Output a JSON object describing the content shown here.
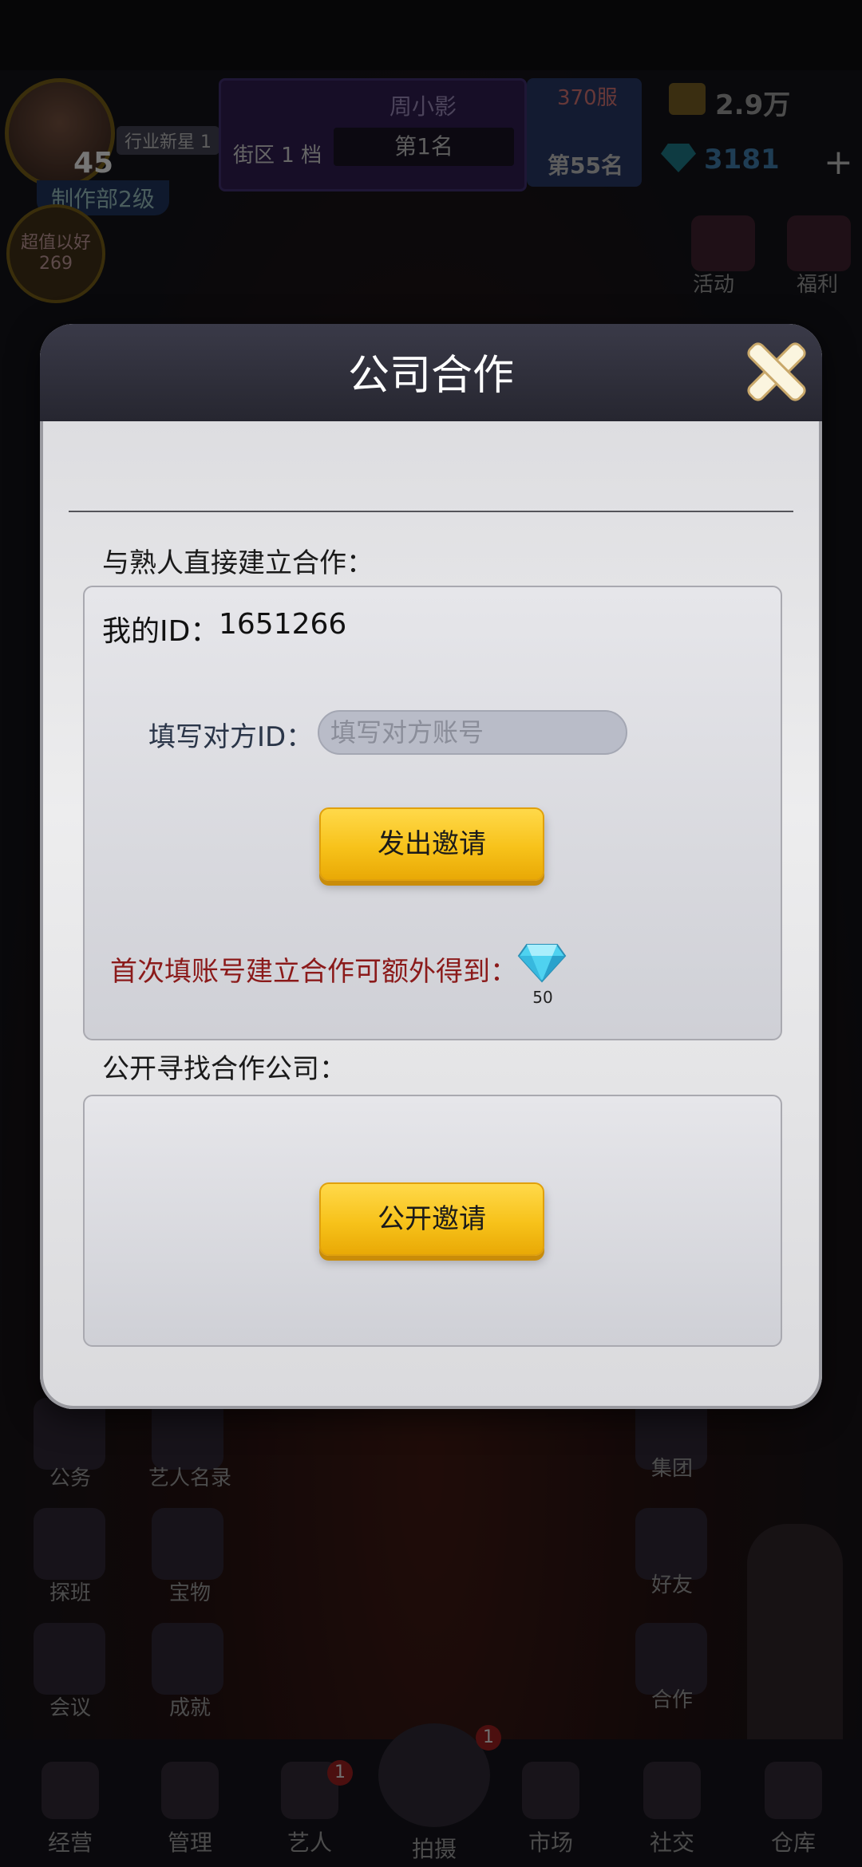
{
  "background": {
    "player_level": "45",
    "rank_tag": "行业新星 1",
    "department": "制作部2级",
    "district_label": "街区 1 档",
    "player_name": "周小影",
    "district_rank": "第1名",
    "server_label": "370服",
    "server_rank": "第55名",
    "gold_amount": "2.9万",
    "gem_amount": "3181",
    "plus_label": "+",
    "bubble_text": "超值以好 269",
    "right_menu": [
      "活动",
      "福利"
    ],
    "grid_items": [
      "公务",
      "艺人名录",
      "集团",
      "探班",
      "宝物",
      "好友",
      "会议",
      "成就",
      "合作"
    ],
    "nav_items": [
      "经营",
      "管理",
      "艺人",
      "拍摄",
      "市场",
      "社交",
      "仓库"
    ],
    "nav_badges": [
      "1",
      "1"
    ]
  },
  "modal": {
    "title": "公司合作",
    "direct_section_label": "与熟人直接建立合作：",
    "my_id_label": "我的ID：",
    "my_id_value": "1651266",
    "friend_id_label": "填写对方ID：",
    "friend_id_placeholder": "填写对方账号",
    "send_invite_button": "发出邀请",
    "bonus_text": "首次填账号建立合作可额外得到：",
    "bonus_gem_count": "50",
    "public_section_label": "公开寻找合作公司：",
    "public_invite_button": "公开邀请"
  },
  "colors": {
    "accent_gold": "#f7c21a",
    "bonus_red": "#8b1a1a",
    "header_dark": "#2e2e3a"
  }
}
